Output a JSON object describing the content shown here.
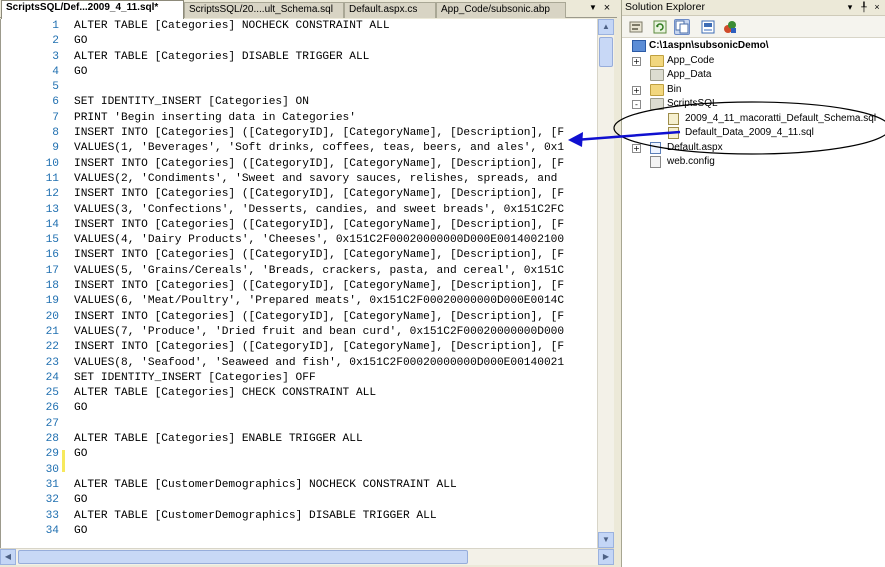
{
  "editor": {
    "tabs": [
      {
        "label": "ScriptsSQL/Def...2009_4_11.sql*",
        "active": true
      },
      {
        "label": "ScriptsSQL/20....ult_Schema.sql",
        "active": false
      },
      {
        "label": "Default.aspx.cs",
        "active": false
      },
      {
        "label": "App_Code/subsonic.abp",
        "active": false
      }
    ],
    "tab_menu_icon": "dropdown-arrow-icon",
    "tab_close_icon": "close-icon",
    "lines": [
      {
        "n": "1",
        "text": "ALTER TABLE [Categories] NOCHECK CONSTRAINT ALL"
      },
      {
        "n": "2",
        "text": "GO"
      },
      {
        "n": "3",
        "text": "ALTER TABLE [Categories] DISABLE TRIGGER ALL"
      },
      {
        "n": "4",
        "text": "GO"
      },
      {
        "n": "5",
        "text": ""
      },
      {
        "n": "6",
        "text": "SET IDENTITY_INSERT [Categories] ON"
      },
      {
        "n": "7",
        "text": "PRINT 'Begin inserting data in Categories'"
      },
      {
        "n": "8",
        "text": "INSERT INTO [Categories] ([CategoryID], [CategoryName], [Description], [F"
      },
      {
        "n": "9",
        "text": "VALUES(1, 'Beverages', 'Soft drinks, coffees, teas, beers, and ales', 0x1"
      },
      {
        "n": "10",
        "text": "INSERT INTO [Categories] ([CategoryID], [CategoryName], [Description], [F"
      },
      {
        "n": "11",
        "text": "VALUES(2, 'Condiments', 'Sweet and savory sauces, relishes, spreads, and"
      },
      {
        "n": "12",
        "text": "INSERT INTO [Categories] ([CategoryID], [CategoryName], [Description], [F"
      },
      {
        "n": "13",
        "text": "VALUES(3, 'Confections', 'Desserts, candies, and sweet breads', 0x151C2FC"
      },
      {
        "n": "14",
        "text": "INSERT INTO [Categories] ([CategoryID], [CategoryName], [Description], [F"
      },
      {
        "n": "15",
        "text": "VALUES(4, 'Dairy Products', 'Cheeses', 0x151C2F00020000000D000E0014002100"
      },
      {
        "n": "16",
        "text": "INSERT INTO [Categories] ([CategoryID], [CategoryName], [Description], [F"
      },
      {
        "n": "17",
        "text": "VALUES(5, 'Grains/Cereals', 'Breads, crackers, pasta, and cereal', 0x151C"
      },
      {
        "n": "18",
        "text": "INSERT INTO [Categories] ([CategoryID], [CategoryName], [Description], [F"
      },
      {
        "n": "19",
        "text": "VALUES(6, 'Meat/Poultry', 'Prepared meats', 0x151C2F00020000000D000E0014C"
      },
      {
        "n": "20",
        "text": "INSERT INTO [Categories] ([CategoryID], [CategoryName], [Description], [F"
      },
      {
        "n": "21",
        "text": "VALUES(7, 'Produce', 'Dried fruit and bean curd', 0x151C2F00020000000D000"
      },
      {
        "n": "22",
        "text": "INSERT INTO [Categories] ([CategoryID], [CategoryName], [Description], [F"
      },
      {
        "n": "23",
        "text": "VALUES(8, 'Seafood', 'Seaweed and fish', 0x151C2F00020000000D000E00140021"
      },
      {
        "n": "24",
        "text": "SET IDENTITY_INSERT [Categories] OFF"
      },
      {
        "n": "25",
        "text": "ALTER TABLE [Categories] CHECK CONSTRAINT ALL"
      },
      {
        "n": "26",
        "text": "GO"
      },
      {
        "n": "27",
        "text": ""
      },
      {
        "n": "28",
        "text": "ALTER TABLE [Categories] ENABLE TRIGGER ALL"
      },
      {
        "n": "29",
        "text": "GO"
      },
      {
        "n": "30",
        "text": ""
      },
      {
        "n": "31",
        "text": "ALTER TABLE [CustomerDemographics] NOCHECK CONSTRAINT ALL"
      },
      {
        "n": "32",
        "text": "GO"
      },
      {
        "n": "33",
        "text": "ALTER TABLE [CustomerDemographics] DISABLE TRIGGER ALL"
      },
      {
        "n": "34",
        "text": "GO"
      }
    ]
  },
  "solution_explorer": {
    "title": "Solution Explorer",
    "title_buttons": [
      "▾",
      "╀",
      "×"
    ],
    "toolbar_icons": [
      "properties-icon",
      "refresh-icon",
      "show-all-files-icon",
      "view-code-icon",
      "view-designer-icon"
    ],
    "tree": [
      {
        "label": "C:\\1aspn\\subsonicDemo\\",
        "type": "project",
        "level": 0,
        "expander": "",
        "bold": true
      },
      {
        "label": "App_Code",
        "type": "folder",
        "level": 1,
        "expander": "+"
      },
      {
        "label": "App_Data",
        "type": "folder",
        "level": 1,
        "expander": ""
      },
      {
        "label": "Bin",
        "type": "folder",
        "level": 1,
        "expander": "+"
      },
      {
        "label": "ScriptsSQL",
        "type": "folder",
        "level": 1,
        "expander": "−"
      },
      {
        "label": "2009_4_11_macoratti_Default_Schema.sql",
        "type": "sql",
        "level": 2,
        "expander": ""
      },
      {
        "label": "Default_Data_2009_4_11.sql",
        "type": "sql",
        "level": 2,
        "expander": ""
      },
      {
        "label": "Default.aspx",
        "type": "aspx",
        "level": 1,
        "expander": "+"
      },
      {
        "label": "web.config",
        "type": "config",
        "level": 1,
        "expander": ""
      }
    ]
  },
  "annotation": {
    "arrow_color": "#1010d0",
    "ellipse_color": "#000000"
  }
}
